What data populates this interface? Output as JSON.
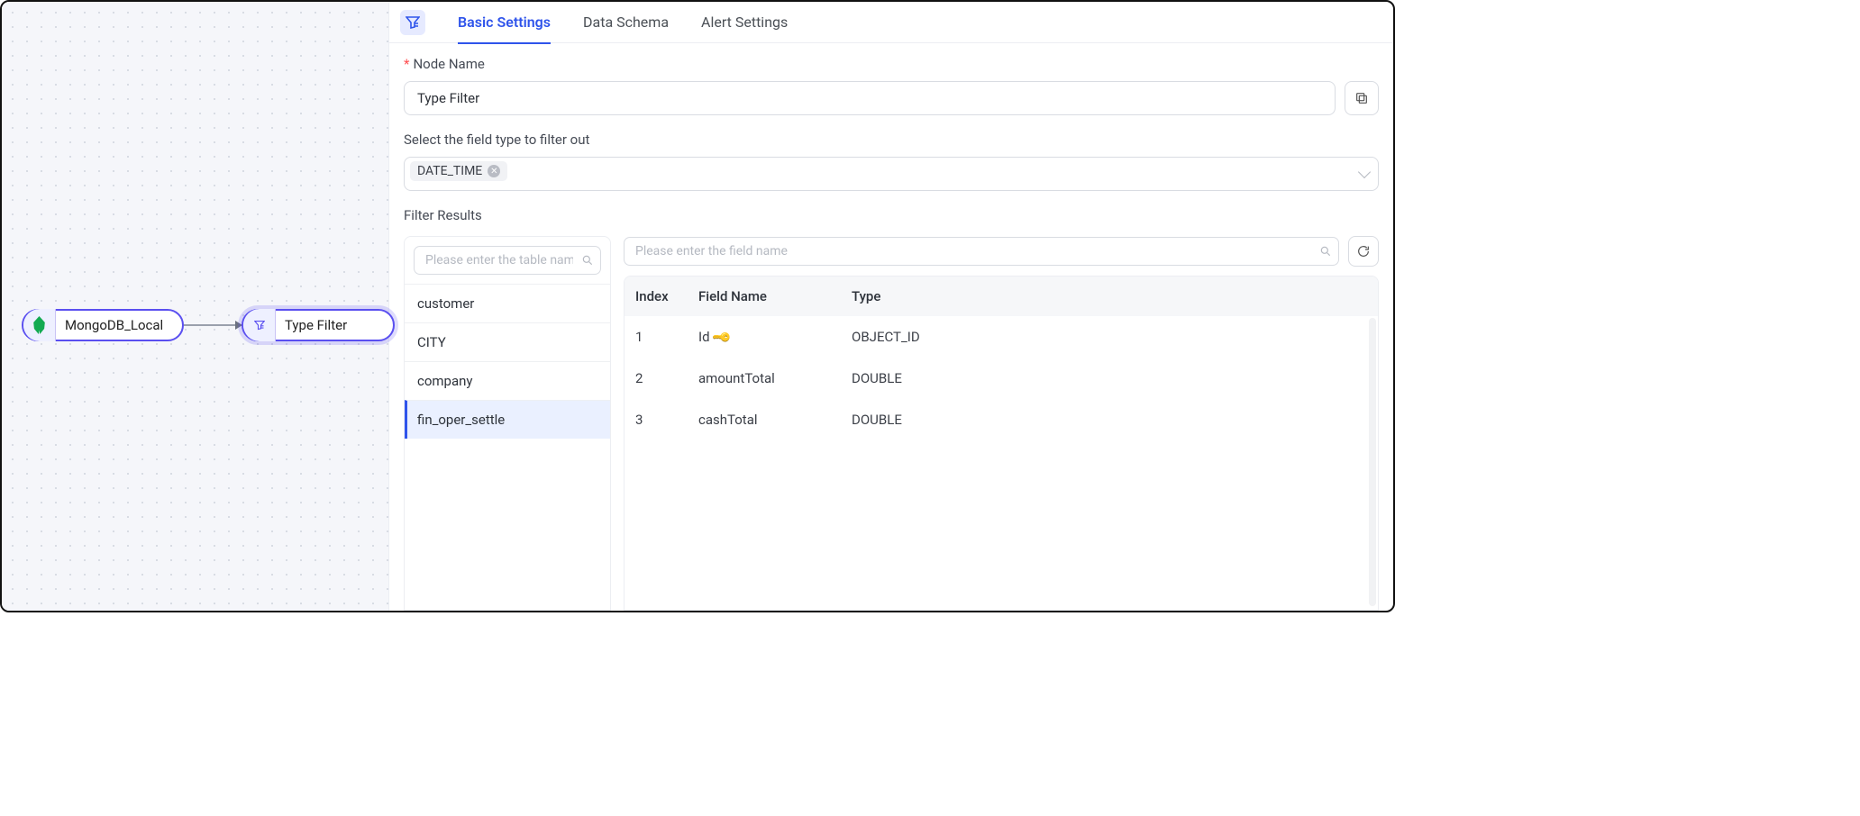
{
  "canvas": {
    "nodes": {
      "mongodb": {
        "label": "MongoDB_Local"
      },
      "filter": {
        "label": "Type Filter"
      }
    }
  },
  "tabs": {
    "basic": "Basic Settings",
    "schema": "Data Schema",
    "alert": "Alert Settings"
  },
  "form": {
    "nodeName": {
      "label": "Node Name",
      "value": "Type Filter"
    },
    "filterTypes": {
      "label": "Select the field type to filter out",
      "tags": [
        "DATE_TIME"
      ]
    },
    "resultsTitle": "Filter Results",
    "tableSearchPlaceholder": "Please enter the table name",
    "fieldSearchPlaceholder": "Please enter the field name",
    "tables": [
      "customer",
      "CITY",
      "company",
      "fin_oper_settle"
    ],
    "selectedTableIndex": 3,
    "fields": {
      "headers": {
        "index": "Index",
        "name": "Field Name",
        "type": "Type"
      },
      "rows": [
        {
          "index": "1",
          "name": "Id",
          "key": true,
          "type": "OBJECT_ID"
        },
        {
          "index": "2",
          "name": "amountTotal",
          "key": false,
          "type": "DOUBLE"
        },
        {
          "index": "3",
          "name": "cashTotal",
          "key": false,
          "type": "DOUBLE"
        }
      ]
    }
  }
}
